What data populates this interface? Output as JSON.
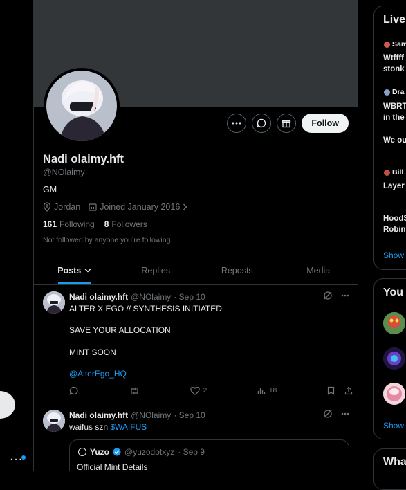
{
  "left": {
    "more_icon": "more-dots-icon"
  },
  "profile": {
    "name": "Nadi olaimy.hft",
    "handle": "@NOlaimy",
    "bio": "GM",
    "location": "Jordan",
    "joined": "Joined January 2016",
    "following_count": "161",
    "following_label": "Following",
    "followers_count": "8",
    "followers_label": "Followers",
    "not_followed": "Not followed by anyone you’re following",
    "follow_label": "Follow"
  },
  "tabs": [
    {
      "label": "Posts"
    },
    {
      "label": "Replies"
    },
    {
      "label": "Reposts"
    },
    {
      "label": "Media"
    }
  ],
  "tweets": [
    {
      "name": "Nadi olaimy.hft",
      "handle": "@NOlaimy",
      "time": "· Sep 10",
      "lines": [
        "ALTER X EGO // SYNTHESIS INITIATED",
        "SAVE YOUR ALLOCATION",
        "MINT SOON"
      ],
      "mention": "@AlterEgo_HQ",
      "likes": "2",
      "views": "18"
    },
    {
      "name": "Nadi olaimy.hft",
      "handle": "@NOlaimy",
      "time": "· Sep 10",
      "text": "waifus szn",
      "cashtag": "$WAIFUS",
      "quote": {
        "name": "Yuzo",
        "handle": "@yuzodotxyz",
        "time": "· Sep 9",
        "text": "Official Mint Details"
      }
    }
  ],
  "sidebar": {
    "live_title": "Live",
    "live_items": [
      {
        "host": "Sam",
        "lines": [
          "Wtffff",
          "stonk"
        ]
      },
      {
        "host": "Dra",
        "lines": [
          "WBRT",
          "in the"
        ]
      },
      {
        "host": "",
        "lines": [
          "We ou"
        ]
      },
      {
        "host": "Bill",
        "lines": [
          "Layer"
        ]
      },
      {
        "host": "",
        "lines": [
          "HoodS",
          "Robin"
        ]
      }
    ],
    "live_show": "Show",
    "you_title": "You",
    "you_show": "Show",
    "what_title": "Wha"
  },
  "colors": {
    "accent": "#1d9bf0",
    "background": "#000000",
    "banner": "#333639"
  }
}
